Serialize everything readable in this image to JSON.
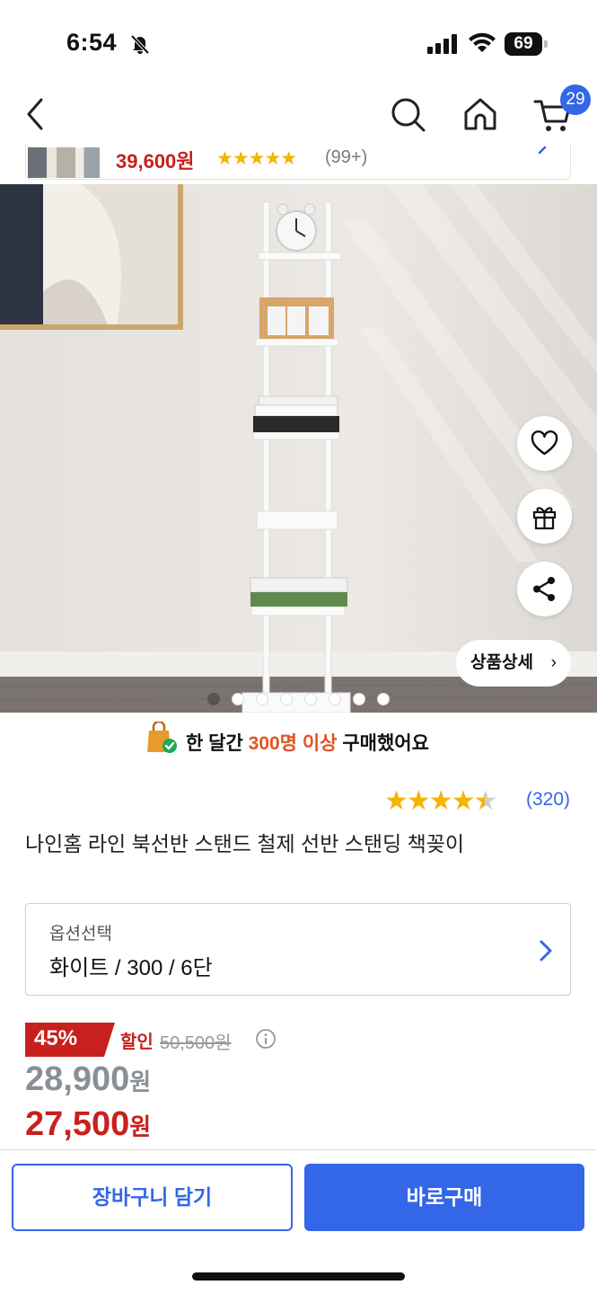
{
  "status_bar": {
    "time": "6:54",
    "battery": "69"
  },
  "nav": {
    "cart_count": "29"
  },
  "sticky": {
    "price": "39,600원",
    "stars": "★★★★★",
    "review_count": "(99+)"
  },
  "hero": {
    "detail_button": "상품상세",
    "detail_chevron": "›",
    "slides_total": 8,
    "slide_active_index": 0
  },
  "purchase_info": {
    "prefix": "한 달간 ",
    "highlight": "300명 이상",
    "suffix": " 구매했어요"
  },
  "rating": {
    "full_stars": "★★★★",
    "half_star": "★",
    "count": "(320)",
    "value": 4.5
  },
  "product": {
    "title": "나인홈 라인 북선반 스탠드 철제 선반 스탠딩 책꽂이"
  },
  "option": {
    "label": "옵션선택",
    "value": "화이트 / 300 / 6단"
  },
  "pricing": {
    "discount_badge": "45%",
    "discount_word": "할인",
    "original_price": "50,500원",
    "mid_price": "28,900",
    "final_price": "27,500",
    "won": "원"
  },
  "bottom": {
    "cart_button": "장바구니 담기",
    "buy_button": "바로구매"
  },
  "colors": {
    "accent": "#3466e8",
    "sale_red": "#c8201d",
    "star": "#f4b400",
    "highlight_orange": "#e2531f"
  }
}
